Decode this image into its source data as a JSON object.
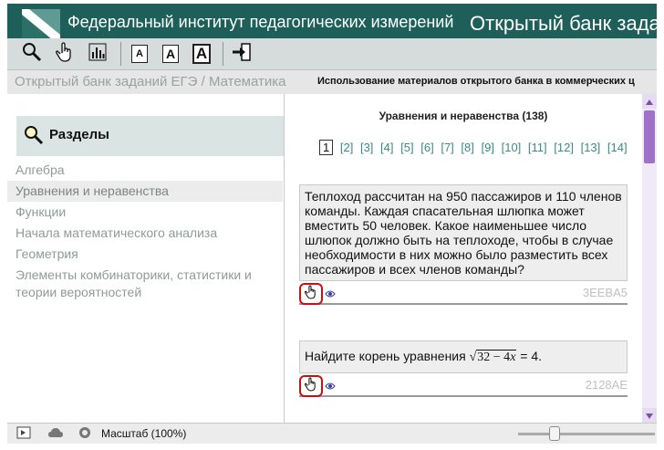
{
  "header": {
    "title": "Федеральный институт педагогических измерений",
    "subtitle": "Открытый банк задан"
  },
  "toolbar": {
    "buttons": [
      {
        "name": "search-icon"
      },
      {
        "name": "hand-icon"
      },
      {
        "name": "chart-icon"
      },
      {
        "name": "font-small-button",
        "label": "A"
      },
      {
        "name": "font-medium-button",
        "label": "A"
      },
      {
        "name": "font-large-button",
        "label": "A"
      },
      {
        "name": "exit-icon"
      }
    ]
  },
  "breadcrumb": {
    "path": "Открытый банк заданий ЕГЭ / Математика",
    "notice": "Использование материалов открытого банка в коммерческих ц"
  },
  "sidebar": {
    "heading": "Разделы",
    "items": [
      {
        "label": "Алгебра"
      },
      {
        "label": "Уравнения и неравенства"
      },
      {
        "label": "Функции"
      },
      {
        "label": "Начала математического анализа"
      },
      {
        "label": "Геометрия"
      },
      {
        "label": "Элементы комбинаторики, статистики и теории вероятностей"
      }
    ],
    "active_index": 1
  },
  "content": {
    "title": "Уравнения и неравенства (138)",
    "pages": [
      "1",
      "[2]",
      "[3]",
      "[4]",
      "[5]",
      "[6]",
      "[7]",
      "[8]",
      "[9]",
      "[10]",
      "[11]",
      "[12]",
      "[13]",
      "[14]"
    ],
    "current_page": "1",
    "tasks": [
      {
        "text": "Теплоход рассчитан на 950 пассажиров и 110 членов команды. Каждая спасательная шлюпка может вместить 50 человек. Какое наименьшее число шлюпок должно быть на теплоходе, чтобы в случае необходимости в них можно было разместить всех пассажиров и всех членов команды?",
        "id": "3EEBA5"
      },
      {
        "prefix": "Найдите корень уравнения ",
        "radicand_a": "32 − 4",
        "radicand_var": "x",
        "suffix": " = 4.",
        "id": "2128AE"
      }
    ]
  },
  "status": {
    "zoom": "Масштаб (100%)"
  },
  "colors": {
    "header_bg": "#1e5f5a",
    "scroll_thumb": "#a071c9",
    "highlight_ring": "#cc1010",
    "link": "#3a8a86"
  }
}
